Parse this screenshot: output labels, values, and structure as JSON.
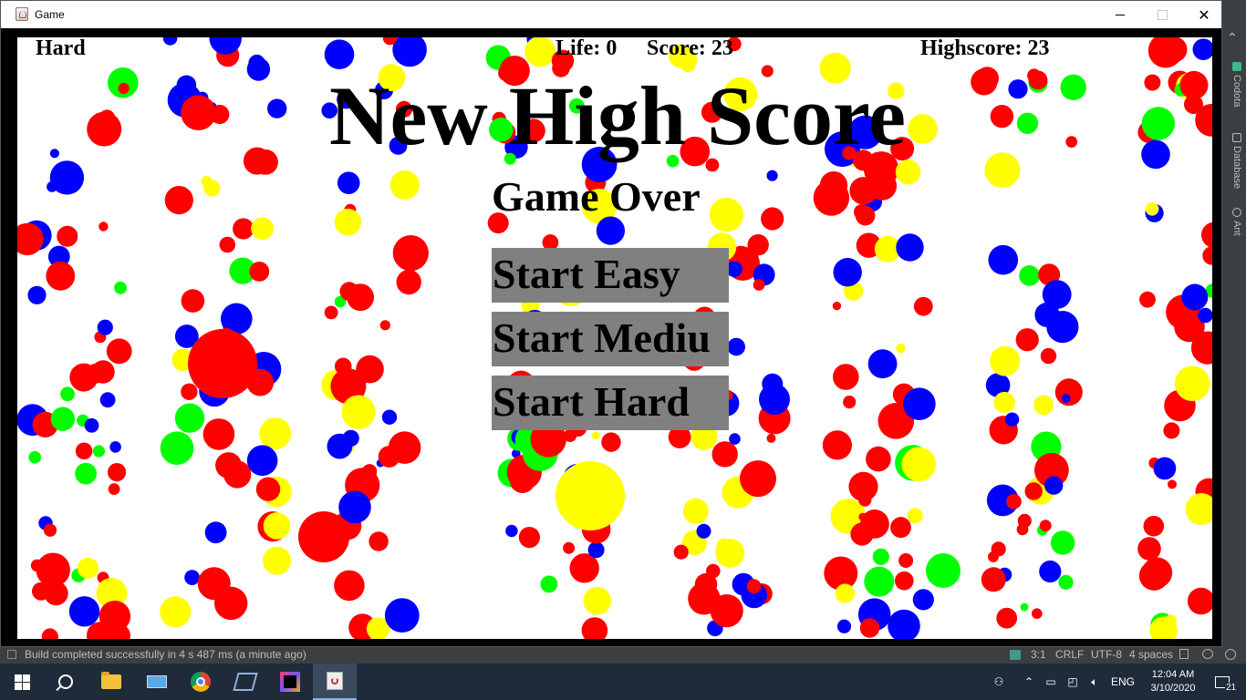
{
  "window": {
    "title": "Game"
  },
  "game": {
    "difficulty": "Hard",
    "life": "Life: 0",
    "score": "Score: 23",
    "highscore": "Highscore: 23",
    "headline": "New High Score",
    "subheadline": "Game Over",
    "buttons": {
      "easy": "Start Easy",
      "medium": "Start Mediu",
      "hard": "Start Hard"
    },
    "colors": {
      "red": "#ff0000",
      "blue": "#0000ff",
      "yellow": "#ffff00",
      "green": "#00ff00",
      "button": "#808080"
    }
  },
  "ide": {
    "tool_tabs": [
      "Codota",
      "Database",
      "Ant"
    ],
    "status_message": "Build completed successfully in 4 s 487 ms (a minute ago)",
    "position": "3:1",
    "line_separator": "CRLF",
    "encoding": "UTF-8",
    "indent": "4 spaces"
  },
  "taskbar": {
    "apps": [
      "start-icon",
      "search-icon",
      "file-explorer-icon",
      "this-pc-icon",
      "chrome-icon",
      "visual-studio-icon",
      "intellij-icon",
      "java-icon"
    ],
    "language": "ENG",
    "time": "12:04 AM",
    "date": "3/10/2020",
    "notifications": "21"
  }
}
